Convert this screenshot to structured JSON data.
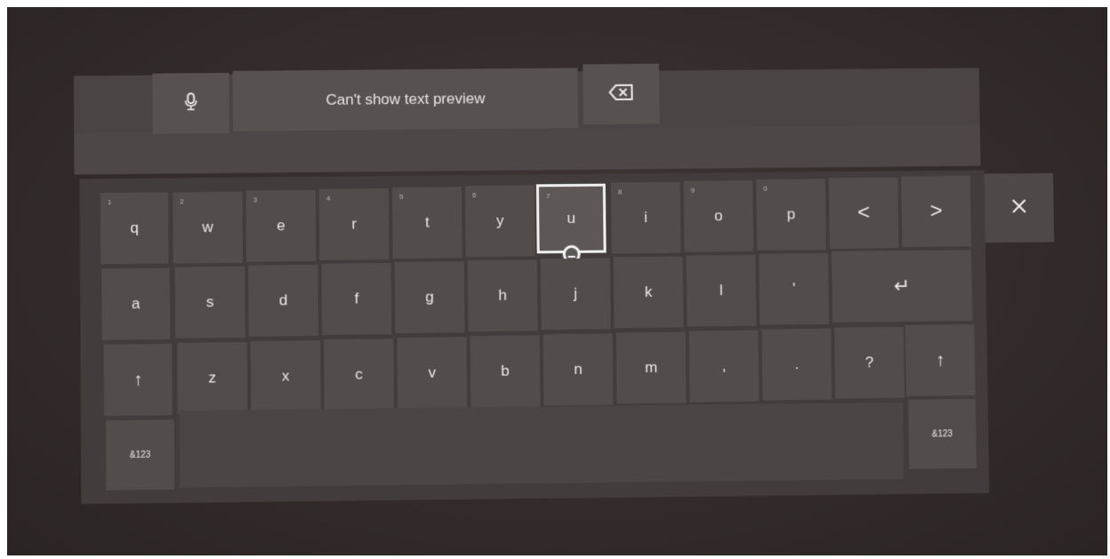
{
  "topbar": {
    "mic_icon": "microphone-icon",
    "preview_text": "Can't show text preview",
    "backspace_icon": "backspace-icon"
  },
  "keyboard": {
    "row1": [
      {
        "label": "q",
        "sup": "1"
      },
      {
        "label": "w",
        "sup": "2"
      },
      {
        "label": "e",
        "sup": "3"
      },
      {
        "label": "r",
        "sup": "4"
      },
      {
        "label": "t",
        "sup": "5"
      },
      {
        "label": "y",
        "sup": "6"
      },
      {
        "label": "u",
        "sup": "7"
      },
      {
        "label": "i",
        "sup": "8"
      },
      {
        "label": "o",
        "sup": "9"
      },
      {
        "label": "p",
        "sup": "0"
      },
      {
        "label": "<",
        "sup": ""
      },
      {
        "label": ">",
        "sup": ""
      }
    ],
    "row2": [
      {
        "label": "a"
      },
      {
        "label": "s"
      },
      {
        "label": "d"
      },
      {
        "label": "f"
      },
      {
        "label": "g"
      },
      {
        "label": "h"
      },
      {
        "label": "j"
      },
      {
        "label": "k"
      },
      {
        "label": "l"
      },
      {
        "label": "'"
      },
      {
        "label": "↵"
      }
    ],
    "row3": [
      {
        "label": "↑"
      },
      {
        "label": "z"
      },
      {
        "label": "x"
      },
      {
        "label": "c"
      },
      {
        "label": "v"
      },
      {
        "label": "b"
      },
      {
        "label": "n"
      },
      {
        "label": "m"
      },
      {
        "label": ","
      },
      {
        "label": "."
      },
      {
        "label": "?"
      },
      {
        "label": "↑"
      }
    ],
    "row4": {
      "left_symbols": "&123",
      "right_symbols": "&123"
    },
    "focused_key": "u",
    "close_label": "✕"
  }
}
